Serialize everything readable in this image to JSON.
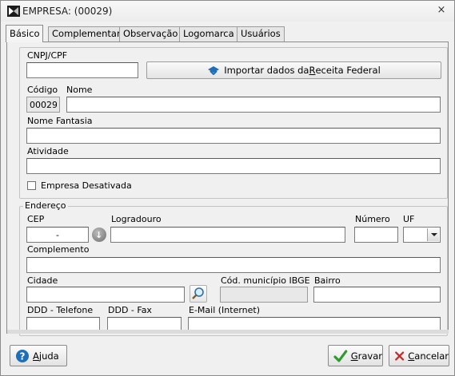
{
  "window": {
    "title": "EMPRESA: (00029)",
    "close_label": "×"
  },
  "tabs": [
    {
      "label": "Básico",
      "active": true
    },
    {
      "label": "Complementar",
      "active": false
    },
    {
      "label": "Observação",
      "active": false
    },
    {
      "label": "Logomarca",
      "active": false
    },
    {
      "label": "Usuários",
      "active": false
    }
  ],
  "basic": {
    "cnpj_label": "CNPJ/CPF",
    "cnpj_value": "",
    "import_prefix": "Importar dados da ",
    "import_accel": "R",
    "import_suffix": "eceita Federal",
    "codigo_label": "Código",
    "codigo_value": "00029",
    "nome_label": "Nome",
    "nome_value": "",
    "fantasia_label": "Nome Fantasia",
    "fantasia_value": "",
    "atividade_label": "Atividade",
    "atividade_value": "",
    "desativada_label": "Empresa Desativada",
    "desativada_checked": false
  },
  "address": {
    "legend": "Endereço",
    "cep_label": "CEP",
    "cep_value": "-",
    "logradouro_label": "Logradouro",
    "logradouro_value": "",
    "numero_label": "Número",
    "numero_value": "",
    "uf_label": "UF",
    "uf_value": "",
    "complemento_label": "Complemento",
    "complemento_value": "",
    "cidade_label": "Cidade",
    "cidade_value": "",
    "ibge_label": "Cód. município IBGE",
    "ibge_value": "",
    "bairro_label": "Bairro",
    "bairro_value": "",
    "ddd_tel_label": "DDD - Telefone",
    "ddd_tel_value": "",
    "ddd_fax_label": "DDD - Fax",
    "ddd_fax_value": "",
    "email_label": "E-Mail (Internet)",
    "email_value": ""
  },
  "footer": {
    "help_accel": "A",
    "help_rest": "juda",
    "save_accel": "G",
    "save_rest": "ravar",
    "cancel_accel": "C",
    "cancel_rest": "ancelar"
  },
  "colors": {
    "accent_blue": "#1e6fb8",
    "save_green": "#2f9a2f",
    "cancel_red": "#c62828"
  }
}
